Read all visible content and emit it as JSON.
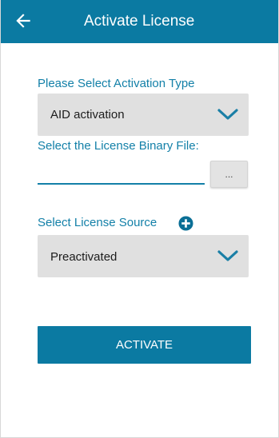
{
  "app_bar": {
    "title": "Activate License",
    "back_icon": "arrow-left-icon",
    "color": "#0b7aa2"
  },
  "activation_type": {
    "label": "Please Select Activation Type",
    "selected": "AID activation",
    "dropdown_icon": "chevron-down-icon"
  },
  "license_file": {
    "label": "Select the License Binary File:",
    "value": "",
    "browse_label": "..."
  },
  "license_source": {
    "label": "Select License Source",
    "add_icon": "plus-circle-icon",
    "selected": "Preactivated",
    "dropdown_icon": "chevron-down-icon"
  },
  "activate_button": {
    "label": "ACTIVATE"
  },
  "colors": {
    "accent": "#0b7aa2",
    "label_text": "#1380a8",
    "select_background": "#e0e0e0"
  }
}
